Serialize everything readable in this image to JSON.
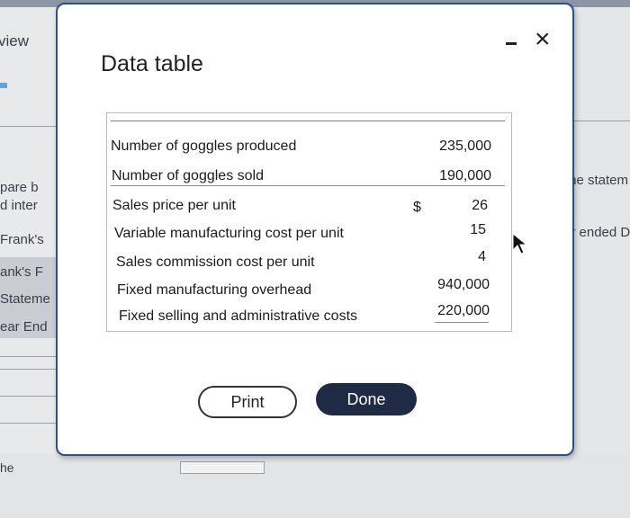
{
  "background": {
    "view_text": "view",
    "left_fragments": [
      "pare b",
      "d inter",
      "Frank's",
      "ank's F",
      "Stateme",
      "ear End"
    ],
    "bottom_text": "he",
    "right_fragments": [
      "me statem",
      "ar ended D"
    ]
  },
  "dialog": {
    "title": "Data table",
    "minimize_label": "-",
    "close_label": "×",
    "rows": [
      {
        "label": "Number of goggles produced",
        "currency": "",
        "value": "235,000"
      },
      {
        "label": "Number of goggles sold",
        "currency": "",
        "value": "190,000"
      },
      {
        "label": "Sales price per unit",
        "currency": "$",
        "value": "26"
      },
      {
        "label": "Variable manufacturing cost per unit",
        "currency": "",
        "value": "15"
      },
      {
        "label": "Sales commission cost per unit",
        "currency": "",
        "value": "4"
      },
      {
        "label": "Fixed manufacturing overhead",
        "currency": "",
        "value": "940,000"
      },
      {
        "label": "Fixed selling and administrative costs",
        "currency": "",
        "value": "220,000"
      }
    ],
    "print_label": "Print",
    "done_label": "Done"
  },
  "colors": {
    "dialog_border": "#2f4f8a",
    "done_button": "#1f2a44"
  }
}
